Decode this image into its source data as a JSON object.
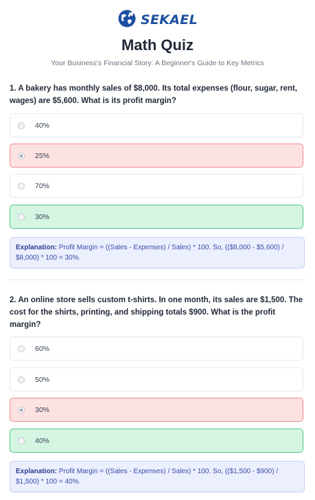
{
  "brand": {
    "name": "SEKAEL",
    "logo_icon": "globe-arrow-icon",
    "color": "#1d4fa0"
  },
  "header": {
    "title": "Math Quiz",
    "subtitle": "Your Business's Financial Story: A Beginner's Guide to Key Metrics"
  },
  "questions": [
    {
      "text": "1. A bakery has monthly sales of $8,000. Its total expenses (flour, sugar, rent, wages) are $5,600. What is its profit margin?",
      "options": [
        {
          "label": "40%",
          "state": "default"
        },
        {
          "label": "25%",
          "state": "selected-wrong"
        },
        {
          "label": "70%",
          "state": "default"
        },
        {
          "label": "30%",
          "state": "correct"
        }
      ],
      "explanation_label": "Explanation:",
      "explanation_text": "Profit Margin = ((Sales - Expenses) / Sales) * 100. So, (($8,000 - $5,600) / $8,000) * 100 = 30%."
    },
    {
      "text": "2. An online store sells custom t-shirts. In one month, its sales are $1,500. The cost for the shirts, printing, and shipping totals $900. What is the profit margin?",
      "options": [
        {
          "label": "60%",
          "state": "default"
        },
        {
          "label": "50%",
          "state": "default"
        },
        {
          "label": "30%",
          "state": "selected-wrong"
        },
        {
          "label": "40%",
          "state": "correct"
        }
      ],
      "explanation_label": "Explanation:",
      "explanation_text": "Profit Margin = ((Sales - Expenses) / Sales) * 100. So, (($1,500 - $900) / $1,500) * 100 = 40%."
    }
  ],
  "colors": {
    "wrong_bg": "#fde2e2",
    "wrong_border": "#f08a8a",
    "correct_bg": "#d5f5e3",
    "correct_border": "#4cc77e",
    "explanation_bg": "#eceffe"
  }
}
